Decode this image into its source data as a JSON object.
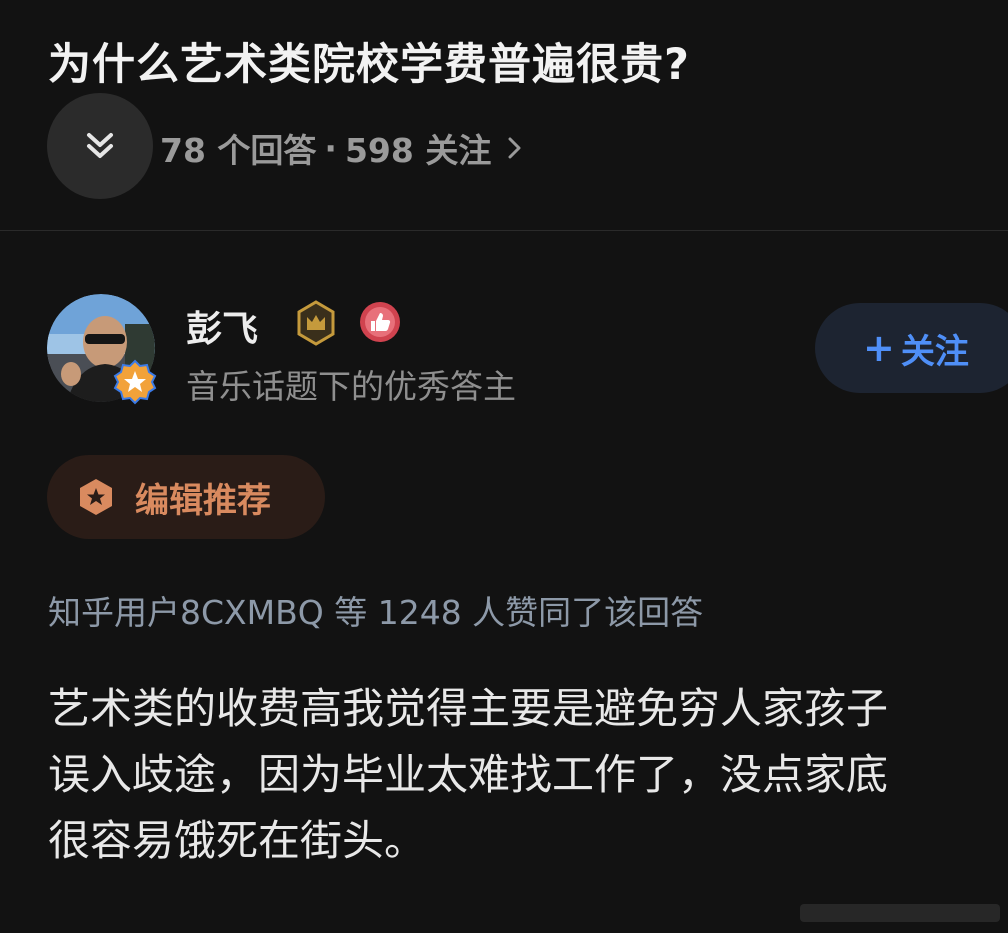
{
  "question": {
    "title": "为什么艺术类院校学费普遍很贵?",
    "answers_count": "78 个回答",
    "separator": "·",
    "followers_count": "598 关注"
  },
  "answer": {
    "author": {
      "name": "彭飞",
      "description": "音乐话题下的优秀答主",
      "follow_label": "关注",
      "follow_prefix": "+"
    },
    "editor_tag": "编辑推荐",
    "voters_text": "知乎用户8CXMBQ 等 1248 人赞同了该回答",
    "content_lines": [
      "艺术类的收费高我觉得主要是避免穷人家孩子",
      "误入歧途，因为毕业太难找工作了，没点家底",
      "很容易饿死在街头。"
    ]
  },
  "icons": {
    "collapse": "double-chevron-down-icon",
    "meta_arrow": "chevron-right-icon",
    "crown": "crown-badge-icon",
    "like": "thumbs-up-badge-icon",
    "avatar_star": "star-badge-icon",
    "editor": "hexagon-star-icon"
  },
  "colors": {
    "background": "#121212",
    "accent_blue": "#4f8ff7",
    "editor_orange": "#d98a5f",
    "crown_gold": "#c59a3c",
    "like_red": "#d0434f"
  }
}
